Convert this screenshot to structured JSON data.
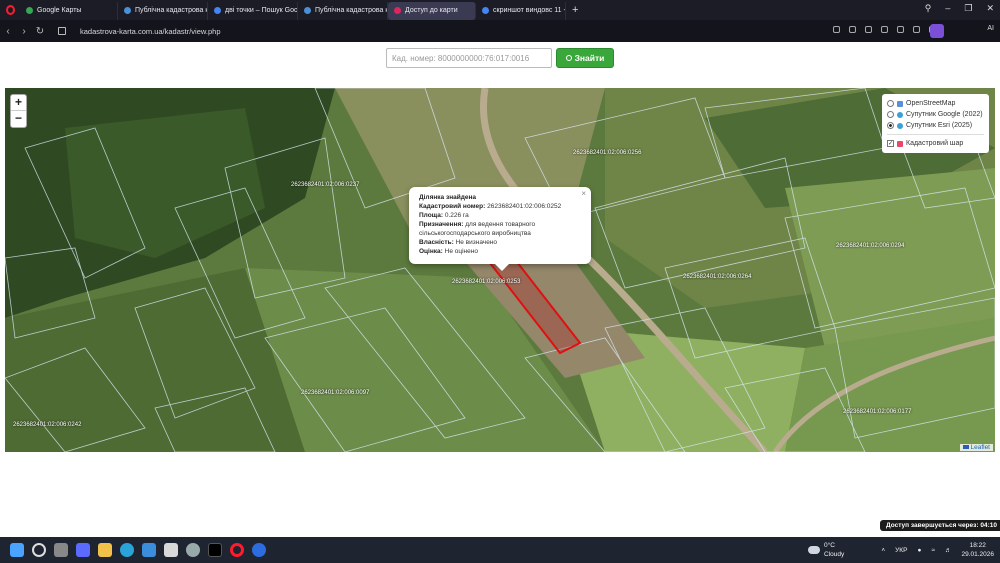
{
  "browser": {
    "tabs": [
      {
        "title": "Google Карты",
        "color": "#34a853",
        "width": 98
      },
      {
        "title": "Публічна кадастрова ка",
        "color": "#4a90d9",
        "width": 90
      },
      {
        "title": "дві точки – Пошук Googl",
        "color": "#4285f4",
        "width": 90
      },
      {
        "title": "Публічна кадастрова ка",
        "color": "#4a90d9",
        "width": 90
      },
      {
        "title": "Доступ до карти",
        "color": "#e0245e",
        "width": 88,
        "active": true
      },
      {
        "title": "скриншот виндовс 11 - П",
        "color": "#4285f4",
        "width": 90
      }
    ],
    "url": "kadastrova-karta.com.ua/kadastr/view.php",
    "ai_label": "AI"
  },
  "search": {
    "placeholder": "Кад. номер: 8000000000:76:017:0016",
    "button_label": "Знайти"
  },
  "map": {
    "zoom_in": "+",
    "zoom_out": "−",
    "layers": {
      "base": [
        {
          "label": "OpenStreetMap",
          "selected": false
        },
        {
          "label": "Супутник Google (2022)",
          "selected": false
        },
        {
          "label": "Супутник Esri (2025)",
          "selected": true
        }
      ],
      "overlay": {
        "label": "Кадастровий шар",
        "checked": true
      }
    },
    "parcel_labels": [
      "2623682401:02:006:0256",
      "2623682401:02:006:0237",
      "2623682401:02:006:0294",
      "2623682401:02:006:0264",
      "2623682401:02:006:0253",
      "2623682401:02:006:0097",
      "2623682401:02:006:0242",
      "2623682401:02:006:0177"
    ],
    "popup": {
      "title": "Ділянка знайдена",
      "rows": [
        {
          "key": "Кадастровий номер:",
          "value": "2623682401:02:006:0252"
        },
        {
          "key": "Площа:",
          "value": "0.226 га"
        },
        {
          "key": "Призначення:",
          "value": "для ведення товарного сільськогосподарського виробництва"
        },
        {
          "key": "Власність:",
          "value": "Не визначено"
        },
        {
          "key": "Оцінка:",
          "value": "Не оцінено"
        }
      ]
    },
    "attribution": "Leaflet",
    "highlight_color": "#e01010"
  },
  "session_notice": {
    "text": "Доступ завершується через:",
    "time": "04:10"
  },
  "taskbar": {
    "weather_temp": "0°C",
    "weather_text": "Cloudy",
    "language": "УКР",
    "time": "18:22",
    "date": "29.01.2026"
  }
}
